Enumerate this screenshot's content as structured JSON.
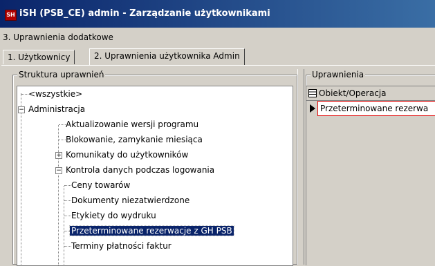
{
  "window": {
    "app_icon_text": "SH",
    "title": "iSH (PSB_CE) admin - Zarządzanie użytkownikami"
  },
  "menubar": {
    "label": "3. Uprawnienia dodatkowe"
  },
  "tabs": [
    {
      "label": "1. Użytkownicy"
    },
    {
      "label": "2. Uprawnienia użytkownika Admin",
      "active": true
    }
  ],
  "left_panel": {
    "title": "Struktura uprawnień",
    "tree": [
      {
        "label": "<wszystkie>",
        "level": 0
      },
      {
        "label": "Administracja",
        "level": 0,
        "expanded": true
      },
      {
        "label": "Aktualizowanie wersji programu",
        "level": 1
      },
      {
        "label": "Blokowanie, zamykanie miesiąca",
        "level": 1
      },
      {
        "label": "Komunikaty do użytkowników",
        "level": 1,
        "collapsed": true
      },
      {
        "label": "Kontrola danych podczas logowania",
        "level": 1,
        "expanded": true
      },
      {
        "label": "Ceny towarów",
        "level": 2
      },
      {
        "label": "Dokumenty niezatwierdzone",
        "level": 2
      },
      {
        "label": "Etykiety do wydruku",
        "level": 2
      },
      {
        "label": "Przeterminowane rezerwacje z GH PSB",
        "level": 2,
        "selected": true
      },
      {
        "label": "Terminy płatności faktur",
        "level": 2
      }
    ]
  },
  "right_panel": {
    "title": "Uprawnienia",
    "column_header": "Obiekt/Operacja",
    "row_value": "Przeterminowane rezerwa"
  },
  "colors": {
    "title_start": "#0a246a",
    "title_end": "#3a6ea5",
    "selection": "#0a246a",
    "edit_border": "#e00000"
  }
}
